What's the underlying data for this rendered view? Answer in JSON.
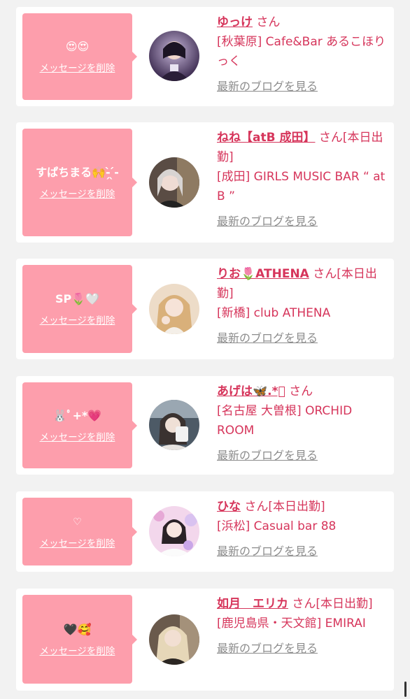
{
  "entries": [
    {
      "message": "😍😍",
      "delete_label": "メッセージを削除",
      "name": "ゆっけ",
      "san_suffix": " さん",
      "shop": "[秋葉原] Cafe&Bar あるこほりっく",
      "blog_label": "最新のブログを見る"
    },
    {
      "message": "すぱちまる🙌-̗̀ ̖́-",
      "delete_label": "メッセージを削除",
      "name": "ねね【atB 成田】",
      "san_suffix": " さん[本日出勤]",
      "shop": "[成田] GIRLS MUSIC BAR “ at B ”",
      "blog_label": "最新のブログを見る"
    },
    {
      "message": "SP🌷🤍",
      "delete_label": "メッセージを削除",
      "name": "りお🌷ATHENA",
      "san_suffix": " さん[本日出勤]",
      "shop": "[新橋] club ATHENA",
      "blog_label": "最新のブログを見る"
    },
    {
      "message": "🐰ﾟ+*💗",
      "delete_label": "メッセージを削除",
      "name": "あげは🦋.*ﾟ",
      "san_suffix": " さん",
      "shop": "[名古屋 大曽根] ORCHID ROOM",
      "blog_label": "最新のブログを見る"
    },
    {
      "message": "♡",
      "delete_label": "メッセージを削除",
      "name": "ひな",
      "san_suffix": " さん[本日出勤]",
      "shop": "[浜松] Casual bar 88",
      "blog_label": "最新のブログを見る"
    },
    {
      "message": "🖤🥰",
      "delete_label": "メッセージを削除",
      "name": "如月　エリカ",
      "san_suffix": " さん[本日出勤]",
      "shop": "[鹿児島県・天文館] EMIRAI",
      "blog_label": "最新のブログを見る"
    }
  ]
}
